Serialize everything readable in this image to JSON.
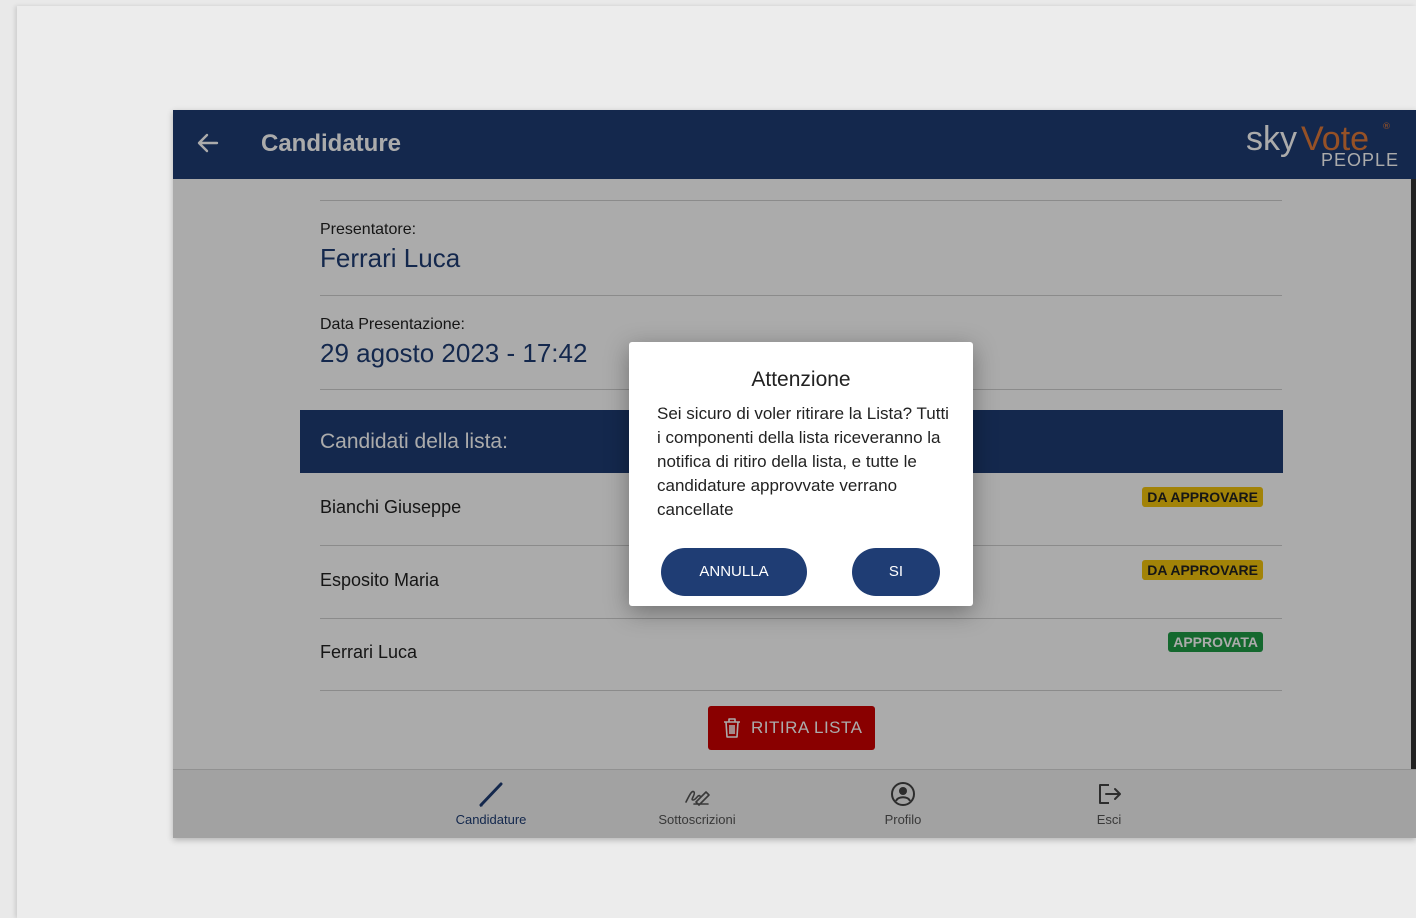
{
  "header": {
    "title": "Candidature",
    "logo": {
      "sky": "sky",
      "vote": "Vote",
      "people": "PEOPLE",
      "reg": "®"
    }
  },
  "details": {
    "presenter_label": "Presentatore:",
    "presenter_value": "Ferrari Luca",
    "date_label": "Data Presentazione:",
    "date_value": "29 agosto 2023 - 17:42"
  },
  "list": {
    "header": "Candidati della lista:",
    "candidates": [
      {
        "name": "Bianchi Giuseppe",
        "status": "DA APPROVARE",
        "status_type": "pending"
      },
      {
        "name": "Esposito Maria",
        "status": "DA APPROVARE",
        "status_type": "pending"
      },
      {
        "name": "Ferrari Luca",
        "status": "APPROVATA",
        "status_type": "approved"
      }
    ]
  },
  "actions": {
    "withdraw_label": "RITIRA LISTA"
  },
  "bottom_nav": {
    "items": [
      {
        "label": "Candidature",
        "icon": "pencil-icon",
        "active": true
      },
      {
        "label": "Sottoscrizioni",
        "icon": "signature-icon",
        "active": false
      },
      {
        "label": "Profilo",
        "icon": "user-circle-icon",
        "active": false
      },
      {
        "label": "Esci",
        "icon": "logout-icon",
        "active": false
      }
    ]
  },
  "dialog": {
    "title": "Attenzione",
    "body": "Sei sicuro di voler ritirare la Lista? Tutti i componenti della lista riceveranno la notifica di ritiro della lista, e tutte le candidature approvvate verrano cancellate",
    "cancel_label": "ANNULLA",
    "confirm_label": "SI"
  },
  "colors": {
    "primary": "#1f3d74",
    "pending": "#f2c40c",
    "approved": "#1f9c45",
    "danger": "#cc0000",
    "logo_accent": "#e07a3a"
  }
}
